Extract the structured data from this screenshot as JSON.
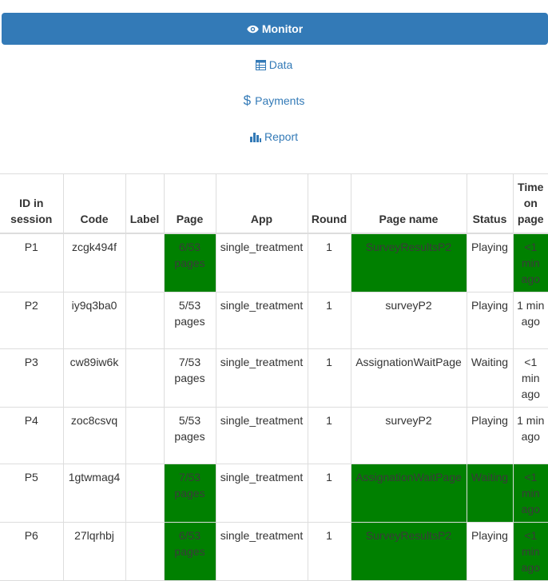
{
  "nav": {
    "monitor": {
      "label": "Monitor",
      "icon": "eye-icon",
      "active": true
    },
    "data": {
      "label": "Data",
      "icon": "table-icon"
    },
    "payments": {
      "label": "Payments",
      "icon": "dollar-icon",
      "symbol": "$"
    },
    "report": {
      "label": "Report",
      "icon": "bar-chart-icon"
    }
  },
  "colors": {
    "accent": "#337ab7",
    "highlight": "#008000"
  },
  "table": {
    "headers": {
      "id_in_session": "ID in session",
      "code": "Code",
      "label": "Label",
      "page": "Page",
      "app": "App",
      "round": "Round",
      "page_name": "Page name",
      "status": "Status",
      "time_on_page": "Time on page"
    },
    "rows": [
      {
        "id": "P1",
        "code": "zcgk494f",
        "label": "",
        "page": "6/53 pages",
        "app": "single_treatment",
        "round": "1",
        "page_name": "SurveyResultsP2",
        "status": "Playing",
        "time": "<1 min ago"
      },
      {
        "id": "P2",
        "code": "iy9q3ba0",
        "label": "",
        "page": "5/53 pages",
        "app": "single_treatment",
        "round": "1",
        "page_name": "surveyP2",
        "status": "Playing",
        "time": "1 min ago"
      },
      {
        "id": "P3",
        "code": "cw89iw6k",
        "label": "",
        "page": "7/53 pages",
        "app": "single_treatment",
        "round": "1",
        "page_name": "AssignationWaitPage",
        "status": "Waiting",
        "time": "<1 min ago"
      },
      {
        "id": "P4",
        "code": "zoc8csvq",
        "label": "",
        "page": "5/53 pages",
        "app": "single_treatment",
        "round": "1",
        "page_name": "surveyP2",
        "status": "Playing",
        "time": "1 min ago"
      },
      {
        "id": "P5",
        "code": "1gtwmag4",
        "label": "",
        "page": "7/53 pages",
        "app": "single_treatment",
        "round": "1",
        "page_name": "AssignationWaitPage",
        "status": "Waiting",
        "time": "<1 min ago"
      },
      {
        "id": "P6",
        "code": "27lqrhbj",
        "label": "",
        "page": "6/53 pages",
        "app": "single_treatment",
        "round": "1",
        "page_name": "SurveyResultsP2",
        "status": "Playing",
        "time": "<1 min ago"
      }
    ]
  }
}
